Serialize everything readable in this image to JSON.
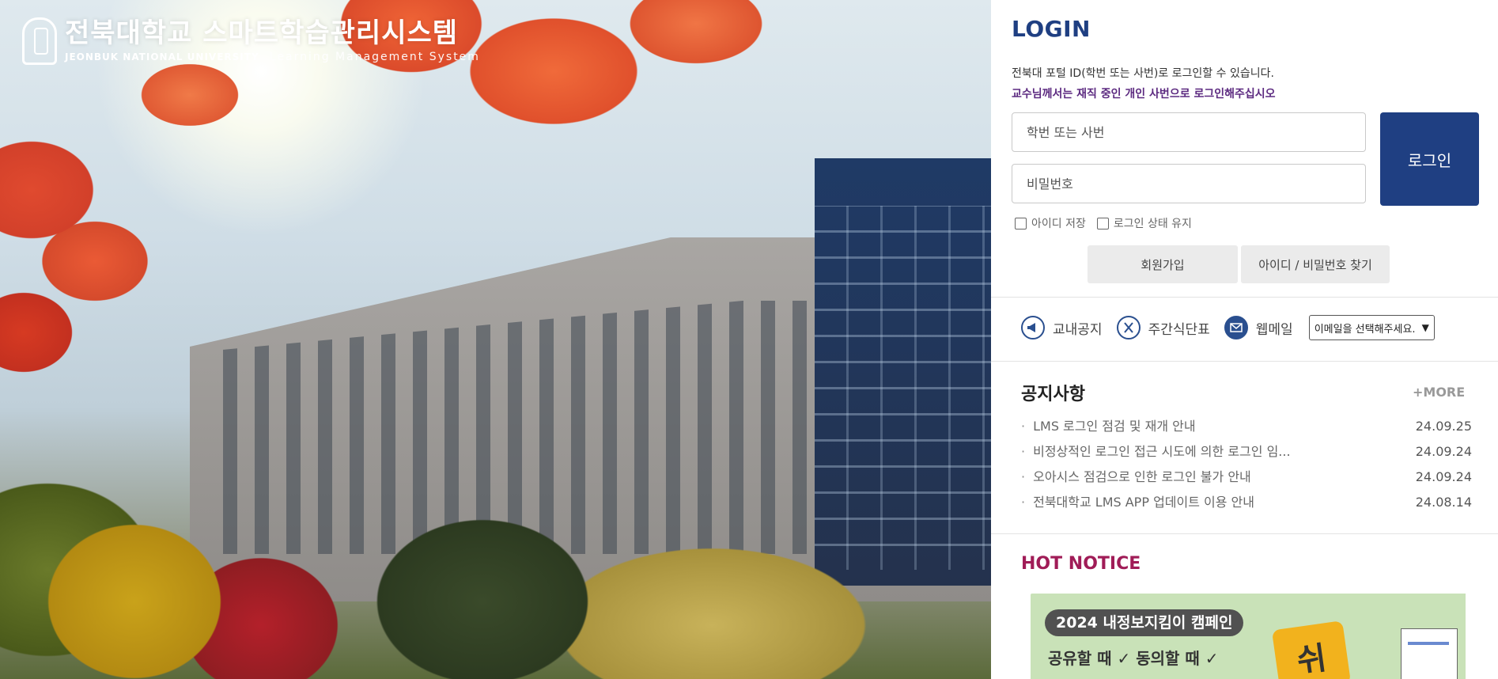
{
  "brand": {
    "title": "전북대학교 스마트학습관리시스템",
    "subtitle_en": "JEONBUK NATIONAL UNIVERSITY",
    "subtitle_en2": "Learning Management System"
  },
  "login": {
    "heading": "LOGIN",
    "info_line1": "전북대 포털 ID(학번 또는 사번)로 로그인할 수 있습니다.",
    "info_line2": "교수님께서는 재직 중인 개인 사번으로 로그인해주십시오",
    "id_placeholder": "학번 또는 사번",
    "password_placeholder": "비밀번호",
    "login_button": "로그인",
    "remember_id": "아이디 저장",
    "keep_login": "로그인 상태 유지",
    "join_button": "회원가입",
    "find_button": "아이디 / 비밀번호 찾기"
  },
  "quick_links": {
    "notice": "교내공지",
    "menu": "주간식단표",
    "webmail": "웹메일",
    "email_select": "이메일을 선택해주세요."
  },
  "notices": {
    "title": "공지사항",
    "more": "+MORE",
    "items": [
      {
        "title": "LMS 로그인 점검 및 재개 안내",
        "date": "24.09.25"
      },
      {
        "title": "비정상적인 로그인 접근 시도에 의한 로그인 임...",
        "date": "24.09.24"
      },
      {
        "title": "오아시스 점검으로 인한 로그인 불가 안내",
        "date": "24.09.24"
      },
      {
        "title": "전북대학교 LMS APP 업데이트 이용 안내",
        "date": "24.08.14"
      }
    ]
  },
  "hot_notice": {
    "title": "HOT NOTICE",
    "banner_pill": "2024 내정보지킴이 캠페인",
    "banner_line": "공유할 때 ✓ 동의할 때 ✓"
  },
  "colors": {
    "primary": "#1f3f82",
    "accent_purple": "#5c2a80",
    "hot": "#a01c57"
  }
}
